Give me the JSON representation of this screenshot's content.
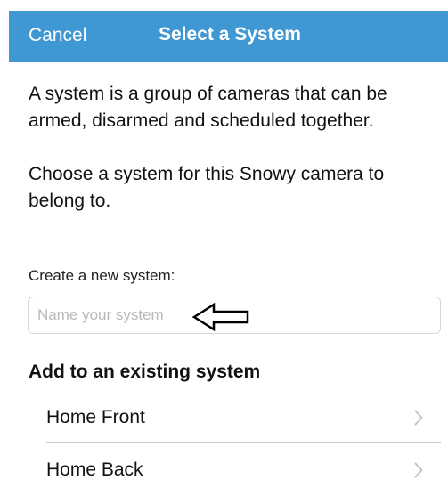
{
  "navbar": {
    "cancel_label": "Cancel",
    "title": "Select a System",
    "background_color": "#3f97d3"
  },
  "intro": {
    "paragraph1": "A system is a group of cameras that can be armed, disarmed and scheduled together.",
    "paragraph2": "Choose a system for this Snowy camera to belong to."
  },
  "create": {
    "label": "Create a new system:",
    "input_value": "",
    "input_placeholder": "Name your system",
    "annotation_icon": "left-arrow-icon"
  },
  "existing": {
    "heading": "Add to an existing system",
    "systems": [
      {
        "label": "Home Front",
        "icon": "chevron-right-icon"
      },
      {
        "label": "Home Back",
        "icon": "chevron-right-icon"
      }
    ]
  }
}
